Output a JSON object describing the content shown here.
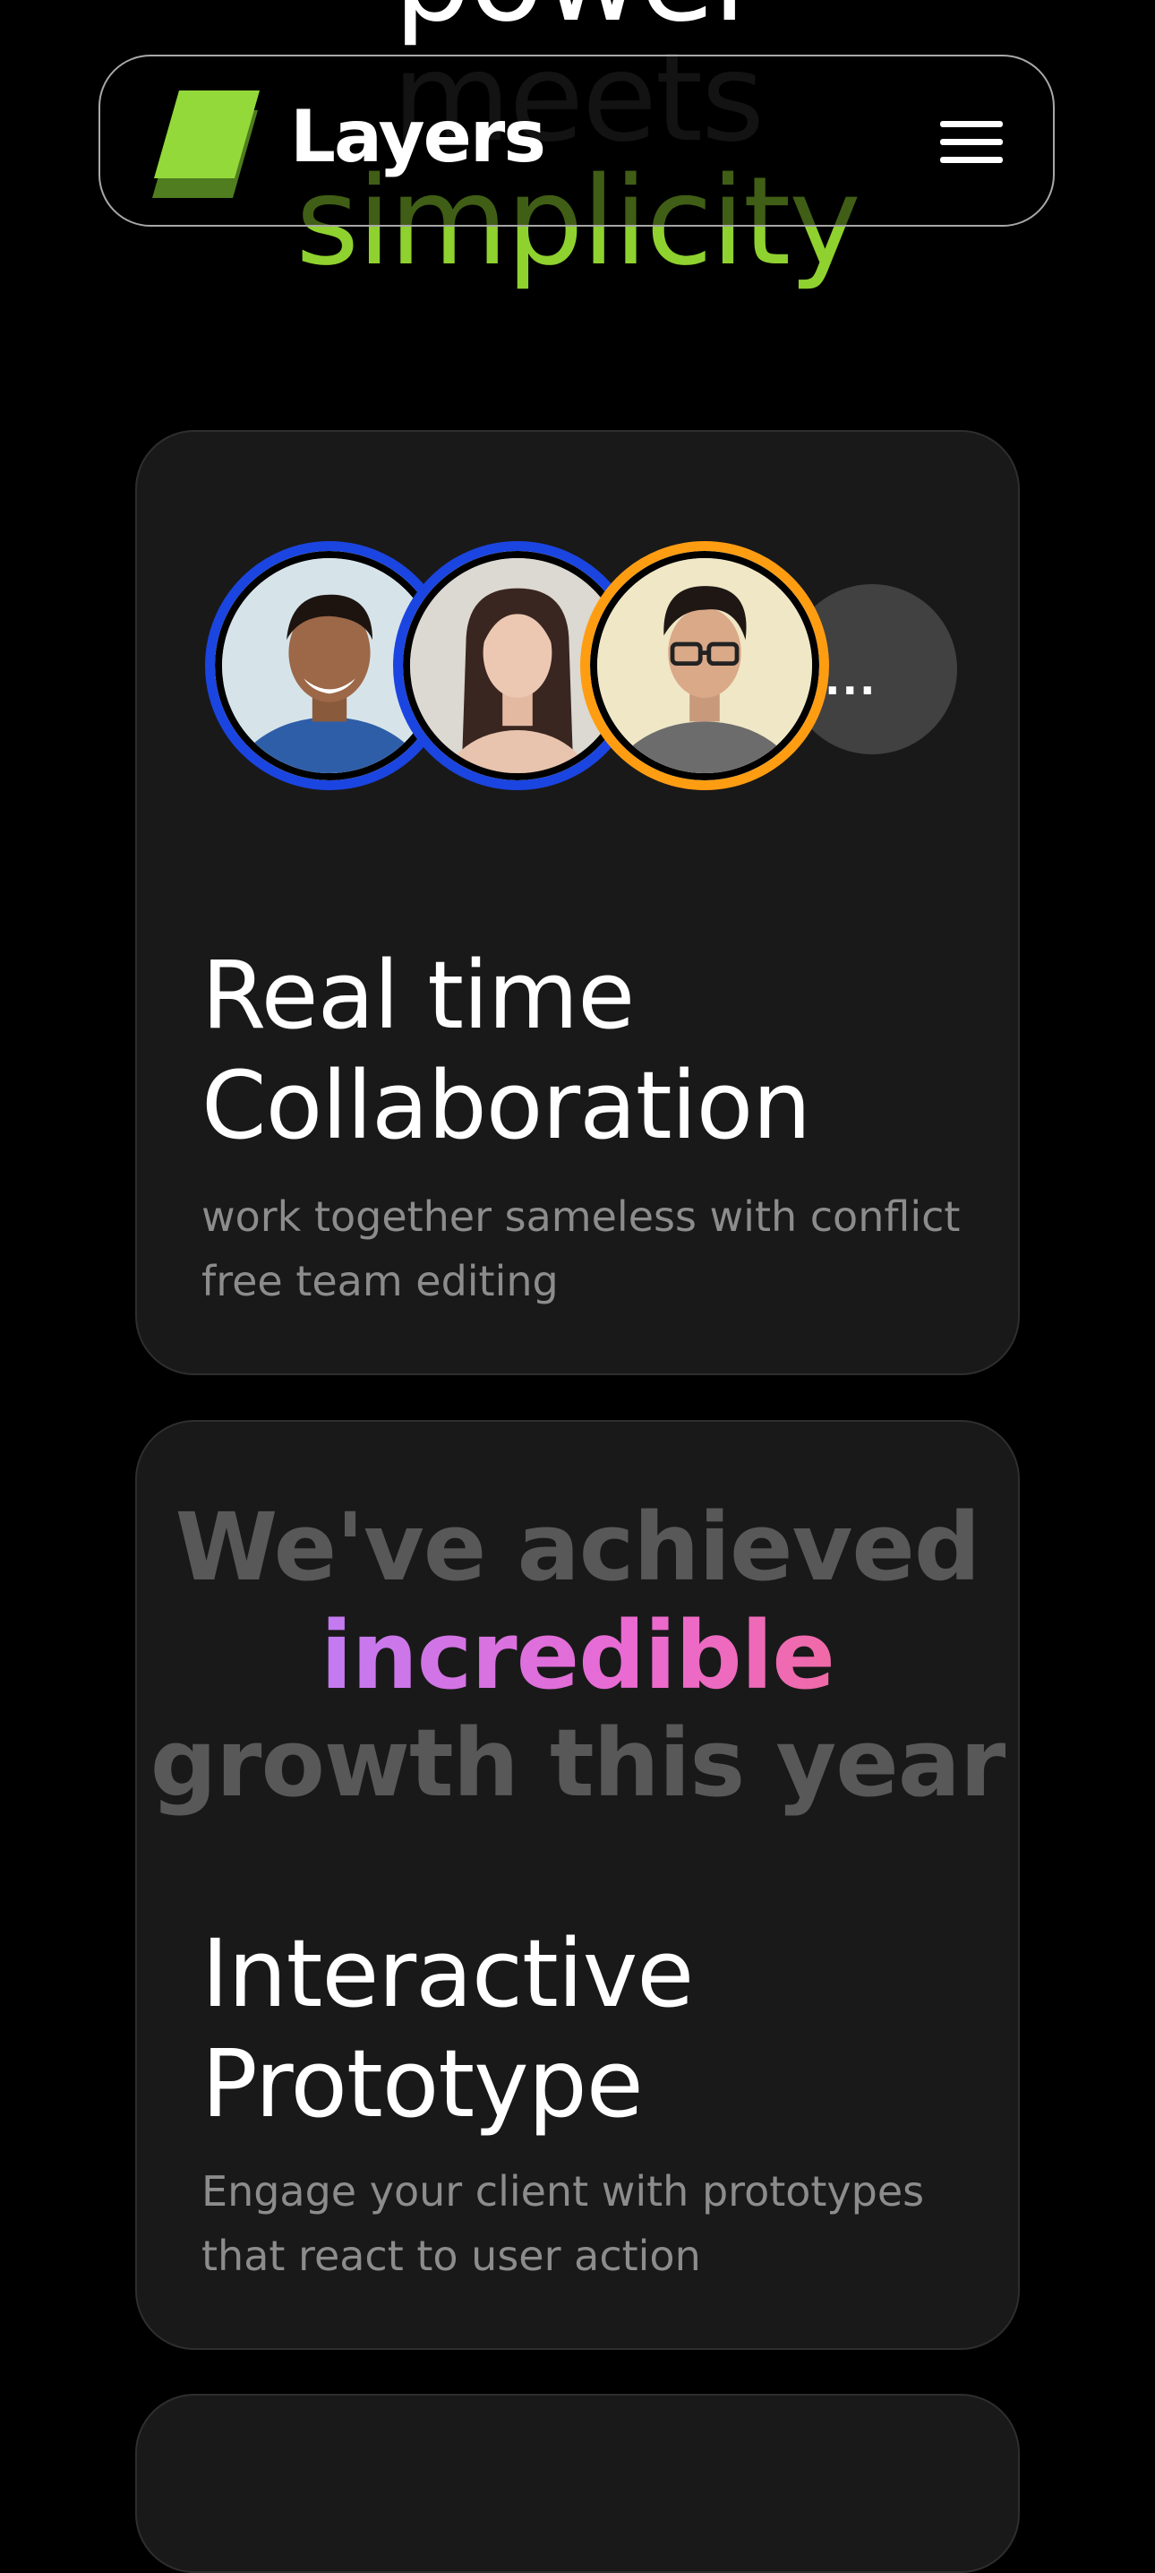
{
  "hero": {
    "line1": "power",
    "line2": "meets",
    "line3": "simplicity"
  },
  "navbar": {
    "brand": "Layers",
    "logo_icon": "layers-logo-icon",
    "menu_icon": "hamburger-menu-icon"
  },
  "cards": [
    {
      "title_line1": "Real time",
      "title_line2": "Collaboration",
      "description": "work together sameless with conflict free team editing",
      "avatars": [
        {
          "name": "avatar-1",
          "ring_color": "#1b45e0"
        },
        {
          "name": "avatar-2",
          "ring_color": "#1b45e0"
        },
        {
          "name": "avatar-3",
          "ring_color": "#ff9d12"
        }
      ],
      "more_label": "..."
    },
    {
      "growth_line1": "We've achieved",
      "growth_highlight": "incredible",
      "growth_line3": "growth this year",
      "title_line1": "Interactive",
      "title_line2": "Prototype",
      "description": "Engage your client with prototypes that react to user action"
    }
  ],
  "colors": {
    "background": "#000000",
    "card": "#191919",
    "accent_green": "#8fd12f",
    "avatar_blue": "#1b45e0",
    "avatar_orange": "#ff9d12",
    "muted_text": "#8c8c8c"
  }
}
